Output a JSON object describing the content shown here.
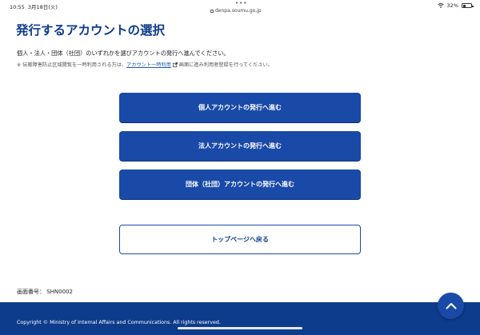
{
  "status_bar": {
    "time": "10:55",
    "date": "3月18日(火)",
    "url": "denpa.soumu.go.jp",
    "battery": "32%",
    "battery_level": 0.32
  },
  "page": {
    "title": "発行するアカウントの選択",
    "description": "個人・法人・団体（社団）のいずれかを選びアカウントの発行へ進んでください。",
    "note_prefix": "※ 伝搬障害防止区域閲覧を一時利用される方は、",
    "note_link": "アカウント一時利用",
    "note_suffix": "画面に進み利用者登録を行ってください。"
  },
  "buttons": {
    "individual": "個人アカウントの発行へ進む",
    "corporate": "法人アカウントの発行へ進む",
    "organization": "団体（社団）アカウントの発行へ進む",
    "top_page": "トップページへ戻る"
  },
  "screen_number": "画面番号： SHN0002",
  "footer": {
    "copyright": "Copyright © Ministry of Internal Affairs and Communications. All rights reserved."
  },
  "colors": {
    "primary": "#1a4aa8",
    "title": "#0d3c8c",
    "footer_bg": "#0d3c8c"
  }
}
